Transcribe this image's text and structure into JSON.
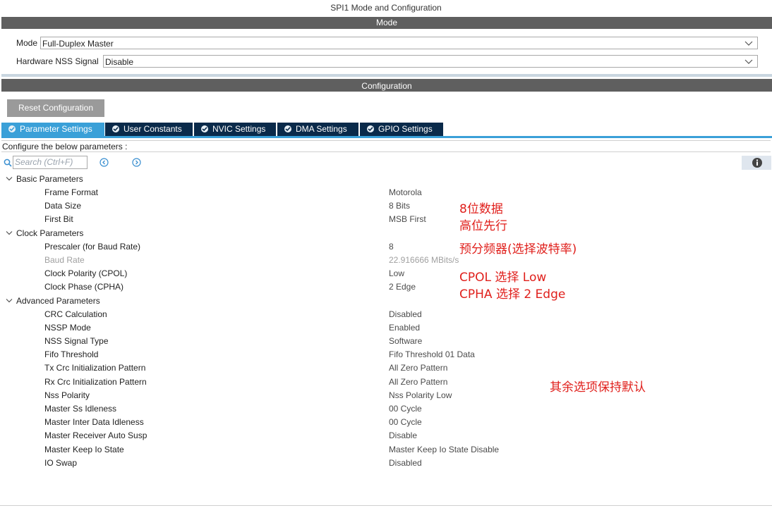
{
  "window": {
    "title": "SPI1 Mode and Configuration"
  },
  "mode_section": {
    "header": "Mode",
    "mode_label": "Mode",
    "mode_value": "Full-Duplex Master",
    "nss_label": "Hardware NSS Signal",
    "nss_value": "Disable"
  },
  "config_section": {
    "header": "Configuration",
    "reset_button": "Reset Configuration",
    "tabs": [
      {
        "label": "Parameter Settings",
        "active": true
      },
      {
        "label": "User Constants",
        "active": false
      },
      {
        "label": "NVIC Settings",
        "active": false
      },
      {
        "label": "DMA Settings",
        "active": false
      },
      {
        "label": "GPIO Settings",
        "active": false
      }
    ],
    "hint": "Configure the below parameters :",
    "search_placeholder": "Search (Ctrl+F)"
  },
  "groups": {
    "basic": {
      "title": "Basic Parameters",
      "params": [
        {
          "name": "Frame Format",
          "value": "Motorola"
        },
        {
          "name": "Data Size",
          "value": "8 Bits"
        },
        {
          "name": "First Bit",
          "value": "MSB First"
        }
      ]
    },
    "clock": {
      "title": "Clock Parameters",
      "params": [
        {
          "name": "Prescaler (for Baud Rate)",
          "value": "8"
        },
        {
          "name": "Baud Rate",
          "value": "22.916666 MBits/s"
        },
        {
          "name": "Clock Polarity (CPOL)",
          "value": "Low"
        },
        {
          "name": "Clock Phase (CPHA)",
          "value": "2 Edge"
        }
      ]
    },
    "advanced": {
      "title": "Advanced Parameters",
      "params": [
        {
          "name": "CRC Calculation",
          "value": "Disabled"
        },
        {
          "name": "NSSP Mode",
          "value": "Enabled"
        },
        {
          "name": "NSS Signal Type",
          "value": "Software"
        },
        {
          "name": "Fifo Threshold",
          "value": "Fifo Threshold 01 Data"
        },
        {
          "name": "Tx Crc Initialization Pattern",
          "value": "All Zero Pattern"
        },
        {
          "name": "Rx Crc Initialization Pattern",
          "value": "All Zero Pattern"
        },
        {
          "name": "Nss Polarity",
          "value": "Nss Polarity Low"
        },
        {
          "name": "Master Ss Idleness",
          "value": "00 Cycle"
        },
        {
          "name": "Master Inter Data Idleness",
          "value": "00 Cycle"
        },
        {
          "name": "Master Receiver Auto Susp",
          "value": "Disable"
        },
        {
          "name": "Master Keep Io State",
          "value": "Master Keep Io State Disable"
        },
        {
          "name": "IO Swap",
          "value": "Disabled"
        }
      ]
    }
  },
  "annotations": {
    "data_size": "8位数据",
    "first_bit": "高位先行",
    "prescaler": "预分频器(选择波特率)",
    "cpol": "CPOL 选择 Low",
    "cpha": "CPHA 选择 2 Edge",
    "others": "其余选项保持默认"
  },
  "colors": {
    "section_bar": "#5f5f5f",
    "tab_active": "#3aa0d8",
    "tab_inactive": "#0a2a4a",
    "annotation": "#e0201c"
  }
}
